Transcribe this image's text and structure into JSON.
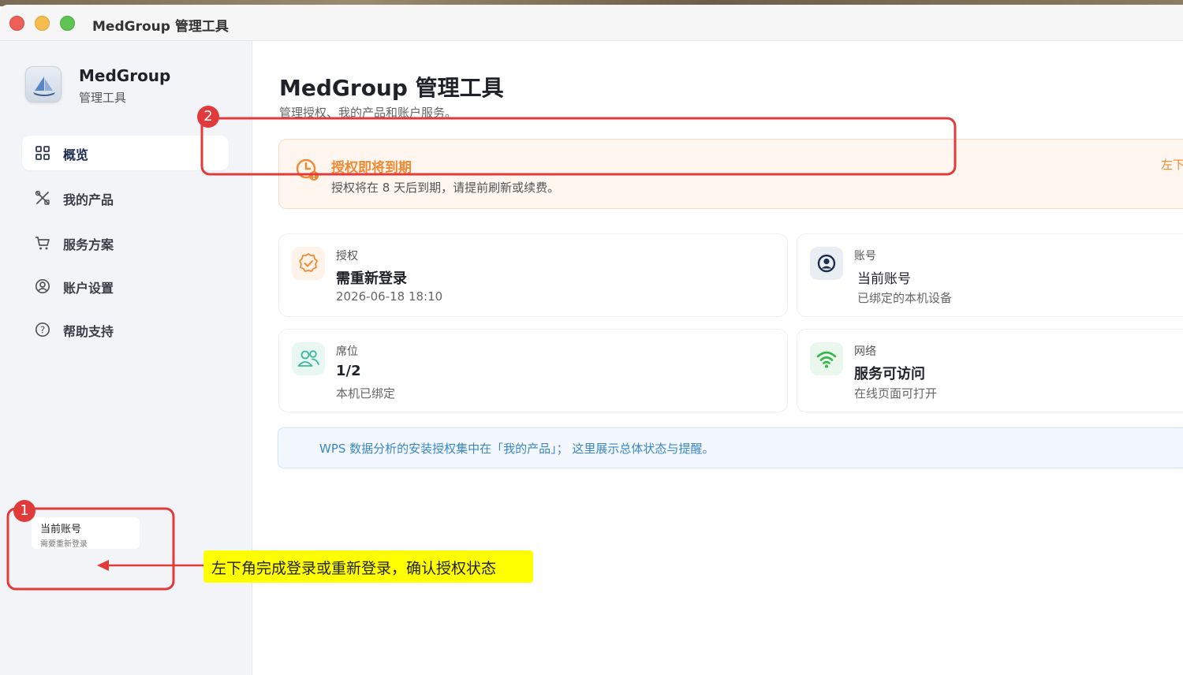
{
  "window": {
    "title": "MedGroup 管理工具"
  },
  "sidebar": {
    "app_name": "MedGroup",
    "app_sub": "管理工具",
    "items": [
      {
        "label": "概览",
        "icon": "grid-icon",
        "active": true
      },
      {
        "label": "我的产品",
        "icon": "tools-icon",
        "active": false
      },
      {
        "label": "服务方案",
        "icon": "cart-icon",
        "active": false
      },
      {
        "label": "账户设置",
        "icon": "user-circle-icon",
        "active": false
      },
      {
        "label": "帮助支持",
        "icon": "help-circle-icon",
        "active": false
      }
    ],
    "account": {
      "title": "当前账号",
      "status": "需要重新登录"
    }
  },
  "main": {
    "title": "MedGroup 管理工具",
    "subtitle": "管理授权、我的产品和账户服务。",
    "alert": {
      "title": "授权即将到期",
      "text": "授权将在 8 天后到期，请提前刷新或续费。",
      "action": "左下"
    },
    "cards": [
      {
        "label": "授权",
        "value": "需重新登录",
        "note": "2026-06-18 18:10",
        "icon": "badge-check-icon"
      },
      {
        "label": "账号",
        "value": "当前账号",
        "note": "已绑定的本机设备",
        "icon": "user-circle-icon"
      },
      {
        "label": "席位",
        "value": "1/2",
        "note": "本机已绑定",
        "icon": "users-icon"
      },
      {
        "label": "网络",
        "value": "服务可访问",
        "note": "在线页面可打开",
        "icon": "wifi-icon"
      }
    ],
    "info": "WPS 数据分析的安装授权集中在「我的产品」； 这里展示总体状态与提醒。"
  },
  "annotations": {
    "badge_1": "1",
    "badge_2": "2",
    "callout": "左下角完成登录或重新登录，确认授权状态"
  },
  "colors": {
    "accent_orange": "#ee8a33",
    "annotation_red": "#e03a3a",
    "info_blue": "#3a86c6",
    "callout_yellow": "#ffff00"
  }
}
